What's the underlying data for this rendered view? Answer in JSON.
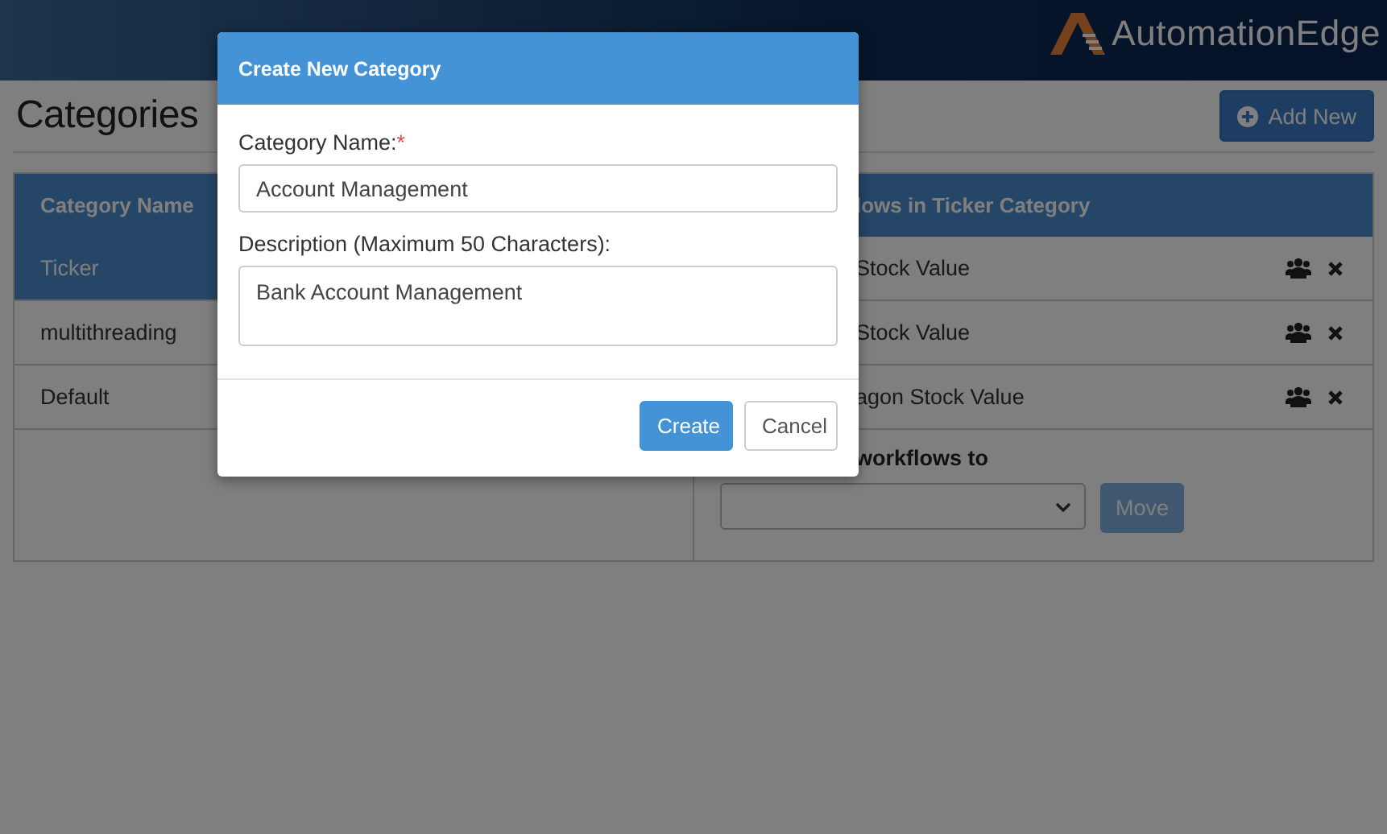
{
  "header": {
    "logo": "AutomationEdge"
  },
  "page": {
    "title": "Categories",
    "add_button": "Add New"
  },
  "categories": {
    "heading": "Category Name",
    "rows": [
      {
        "name": "Ticker",
        "selected": true
      },
      {
        "name": "multithreading",
        "selected": false
      },
      {
        "name": "Default",
        "selected": false
      }
    ]
  },
  "workflows": {
    "heading": "lows in Ticker Category",
    "rows": [
      {
        "name": "Stock Value"
      },
      {
        "name": "Stock Value"
      },
      {
        "name": "agon Stock Value"
      }
    ],
    "move_label": "workflows to",
    "move_button": "Move"
  },
  "modal": {
    "title": "Create New Category",
    "name_label": "Category Name:",
    "required_mark": "*",
    "name_value": "Account Management",
    "description_label": "Description (Maximum 50 Characters):",
    "description_value": "Bank Account Management",
    "buttons": [
      {
        "label": "Create",
        "kind": "primary"
      },
      {
        "label": "Cancel",
        "kind": "default"
      }
    ]
  }
}
